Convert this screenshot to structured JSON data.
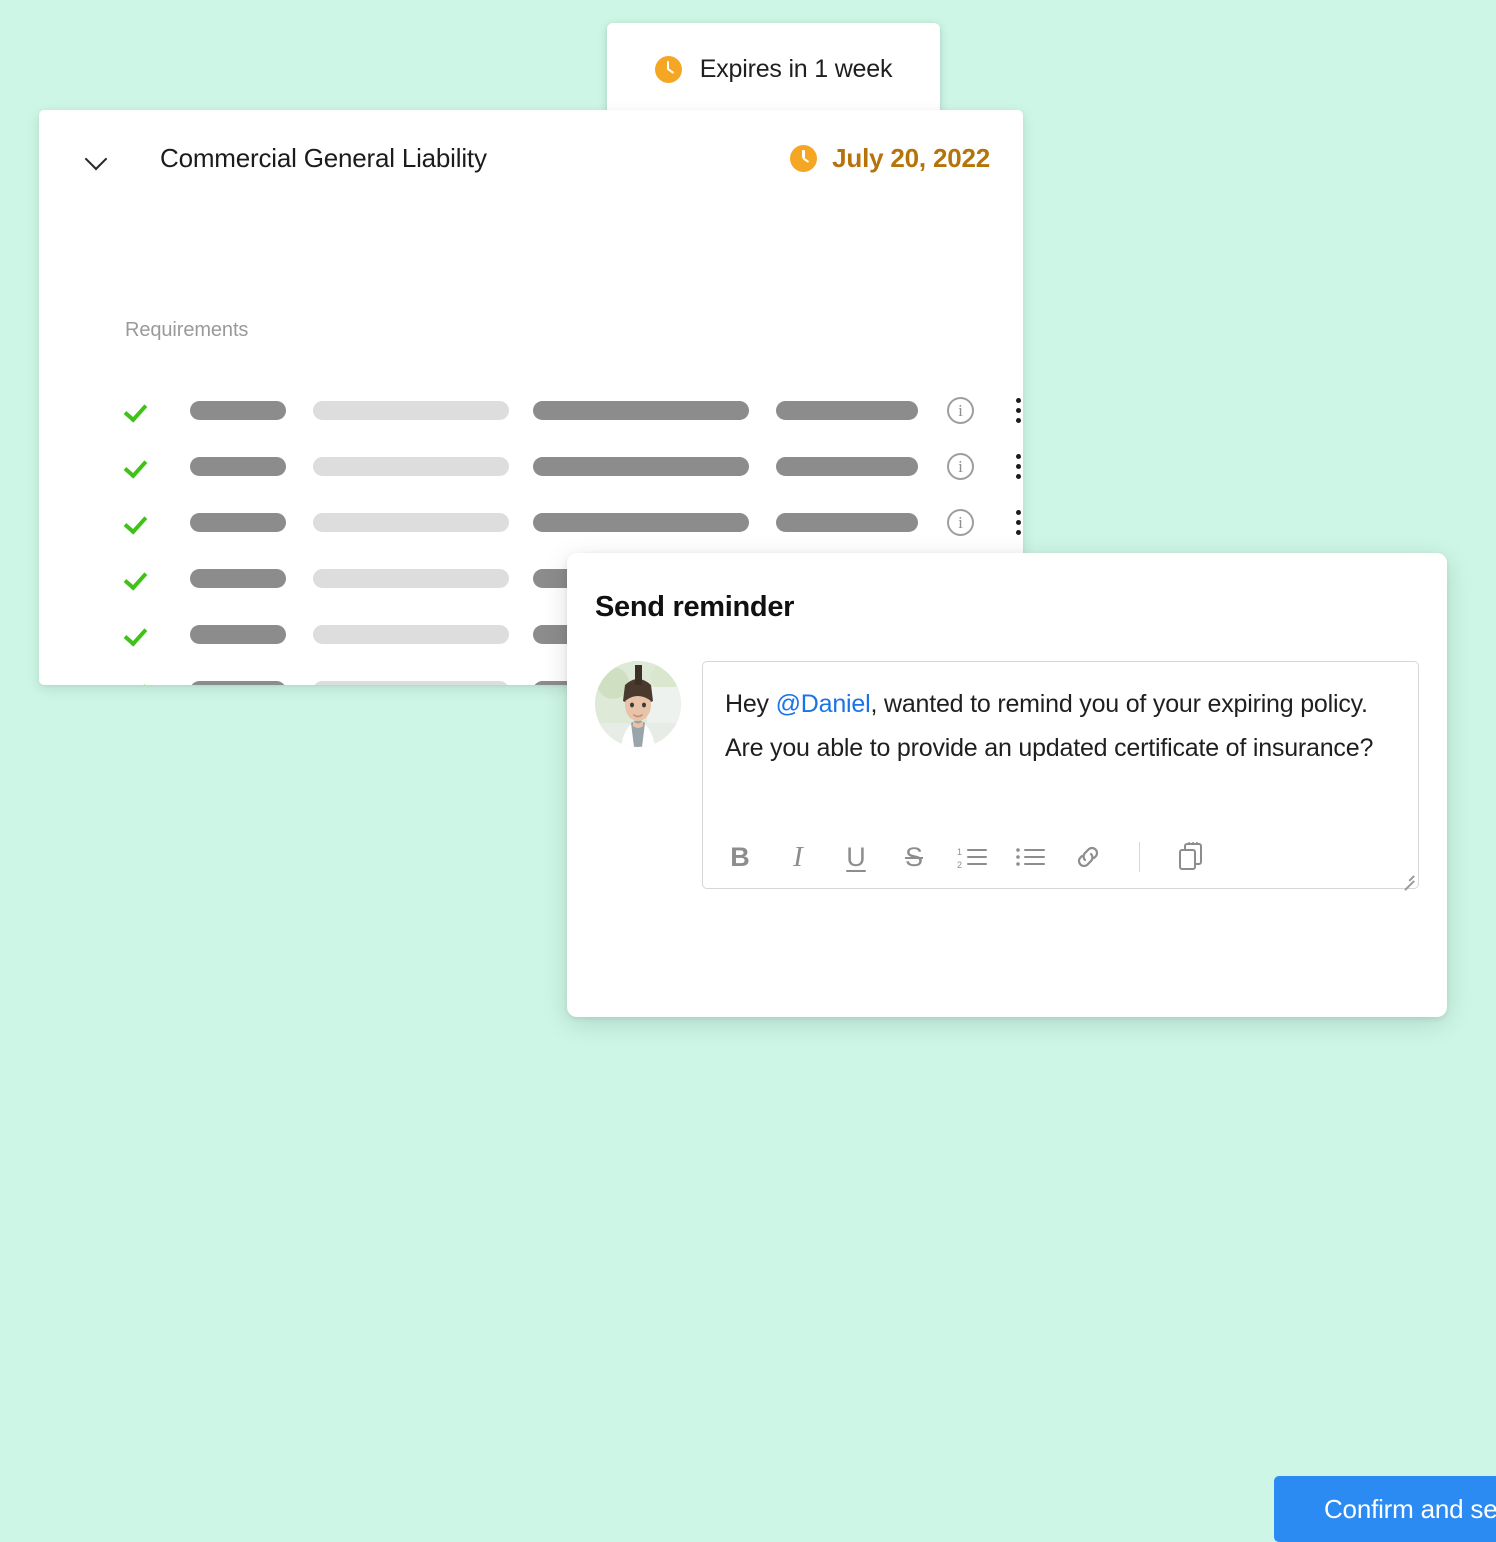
{
  "background_color": "#cdf6e6",
  "tooltip": {
    "text": "Expires in 1 week",
    "icon": "clock-icon",
    "icon_color": "#f5a623"
  },
  "card": {
    "collapse_icon": "chevron-down-icon",
    "title": "Commercial General Liability",
    "expiry": {
      "icon": "clock-icon",
      "date": "July 20, 2022",
      "color": "#b5730a"
    },
    "section_label": "Requirements",
    "row_icons": {
      "status": "check-icon",
      "status_color": "#3fc319",
      "info": "info-circle-icon",
      "menu": "kebab-menu-icon"
    },
    "rows": [
      {
        "status": "complete",
        "has_info": true,
        "has_menu": true
      },
      {
        "status": "complete",
        "has_info": true,
        "has_menu": true
      },
      {
        "status": "complete",
        "has_info": true,
        "has_menu": true
      },
      {
        "status": "complete",
        "has_info": true,
        "has_menu": true
      },
      {
        "status": "complete",
        "has_info": true,
        "has_menu": true
      },
      {
        "status": "complete",
        "has_info": false,
        "has_menu": false
      },
      {
        "status": "complete",
        "has_info": false,
        "has_menu": false
      }
    ]
  },
  "dialog": {
    "title": "Send reminder",
    "avatar": "user-avatar",
    "message": {
      "prefix": "Hey ",
      "mention": "@Daniel",
      "mention_color": "#1a73e8",
      "rest": ", wanted to remind you of your expiring policy. Are you able to provide an updated certificate of insurance?"
    },
    "toolbar": [
      {
        "name": "bold-icon",
        "label": "B"
      },
      {
        "name": "italic-icon",
        "label": "I"
      },
      {
        "name": "underline-icon",
        "label": "U"
      },
      {
        "name": "strikethrough-icon",
        "label": "S"
      },
      {
        "name": "numbered-list-icon",
        "label": ""
      },
      {
        "name": "bulleted-list-icon",
        "label": ""
      },
      {
        "name": "link-icon",
        "label": ""
      },
      {
        "name": "template-clipboard-icon",
        "label": ""
      }
    ],
    "confirm_label": "Confirm and send",
    "confirm_color": "#2b8bf2"
  }
}
